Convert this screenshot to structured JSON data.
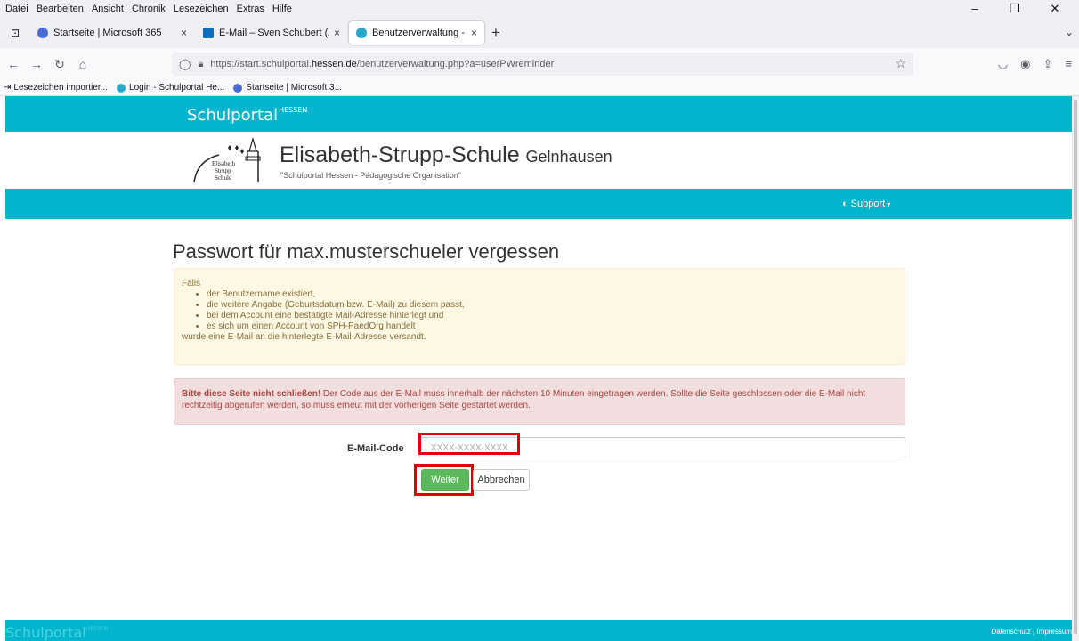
{
  "browser": {
    "menu": [
      "Datei",
      "Bearbeiten",
      "Ansicht",
      "Chronik",
      "Lesezeichen",
      "Extras",
      "Hilfe"
    ],
    "tabs": [
      {
        "title": "Startseite | Microsoft 365",
        "close": "×"
      },
      {
        "title": "E-Mail – Sven Schubert (Admin",
        "close": "×"
      },
      {
        "title": "Benutzerverwaltung - Schulport",
        "close": "×"
      }
    ],
    "new_tab": "+",
    "url_prefix": "https://start.schulportal.",
    "url_domain": "hessen.de",
    "url_path": "/benutzerverwaltung.php?a=userPWreminder",
    "bookmarks": [
      {
        "label": "Lesezeichen importier...",
        "icon": "import-icon"
      },
      {
        "label": "Login - Schulportal He...",
        "icon": "globe-icon"
      },
      {
        "label": "Startseite | Microsoft 3...",
        "icon": "m365-icon"
      }
    ]
  },
  "portal": {
    "brand": "Schulportal",
    "brand_sup": "HESSEN",
    "school_name": "Elisabeth-Strupp-Schule",
    "school_city": "Gelnhausen",
    "school_subtitle": "\"Schulportal Hessen - Pädagogische Organisation\"",
    "crest_text": [
      "Elisabeth",
      "Strupp",
      "Schule"
    ],
    "support_label": "Support"
  },
  "main": {
    "heading": "Passwort für max.musterschueler vergessen",
    "info_intro": "Falls",
    "info_items": [
      "der Benutzername existiert,",
      "die weitere Angabe (Geburtsdatum bzw. E-Mail) zu diesem passt,",
      "bei dem Account eine bestätigte Mail-Adresse hinterlegt und",
      "es sich um einen Account von SPH-PaedOrg handelt"
    ],
    "info_outro": "wurde eine E-Mail an die hinterlegte E-Mail-Adresse versandt.",
    "warning_bold": "Bitte diese Seite nicht schließen!",
    "warning_text": " Der Code aus der E-Mail muss innerhalb der nächsten 10 Minuten eingetragen werden. Sollte die Seite geschlossen oder die E-Mail nicht rechtzeitig abgerufen werden, so muss erneut mit der vorherigen Seite gestartet werden.",
    "code_label": "E-Mail-Code",
    "code_placeholder": "XXXX-XXXX-XXXX",
    "btn_next": "Weiter",
    "btn_cancel": "Abbrechen"
  },
  "footer": {
    "brand": "Schulportal",
    "brand_sup": "HESSEN",
    "links": "Datenschutz | Impressum"
  },
  "colors": {
    "accent": "#00b5cc",
    "highlight": "#e00000",
    "success": "#5cb85c"
  }
}
